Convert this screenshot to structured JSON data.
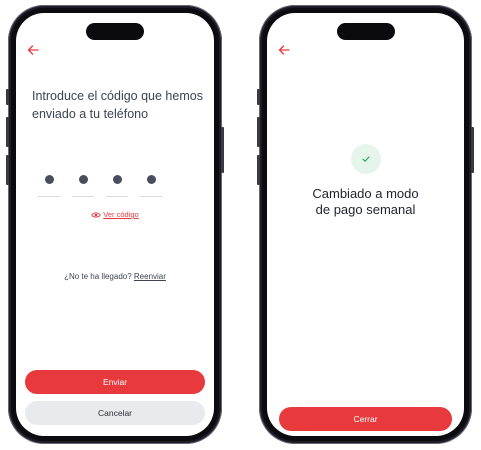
{
  "colors": {
    "accent": "#e8393d",
    "text": "#3c4354",
    "secondary_button": "#e9eaed",
    "success_bg": "#e6f5ec",
    "success_icon": "#3aa36a"
  },
  "screen1": {
    "title": "Introduce el código que hemos enviado a tu teléfono",
    "code_digits": [
      "•",
      "•",
      "•",
      "•"
    ],
    "view_code": {
      "icon": "eye-icon",
      "label": "Ver código"
    },
    "no_code_text": "¿No te ha llegado?",
    "resend_label": "Reenviar",
    "send_label": "Enviar",
    "cancel_label": "Cancelar"
  },
  "screen2": {
    "icon": "check-icon",
    "title_line1": "Cambiado a modo",
    "title_line2": "de pago semanal",
    "close_label": "Cerrar"
  }
}
